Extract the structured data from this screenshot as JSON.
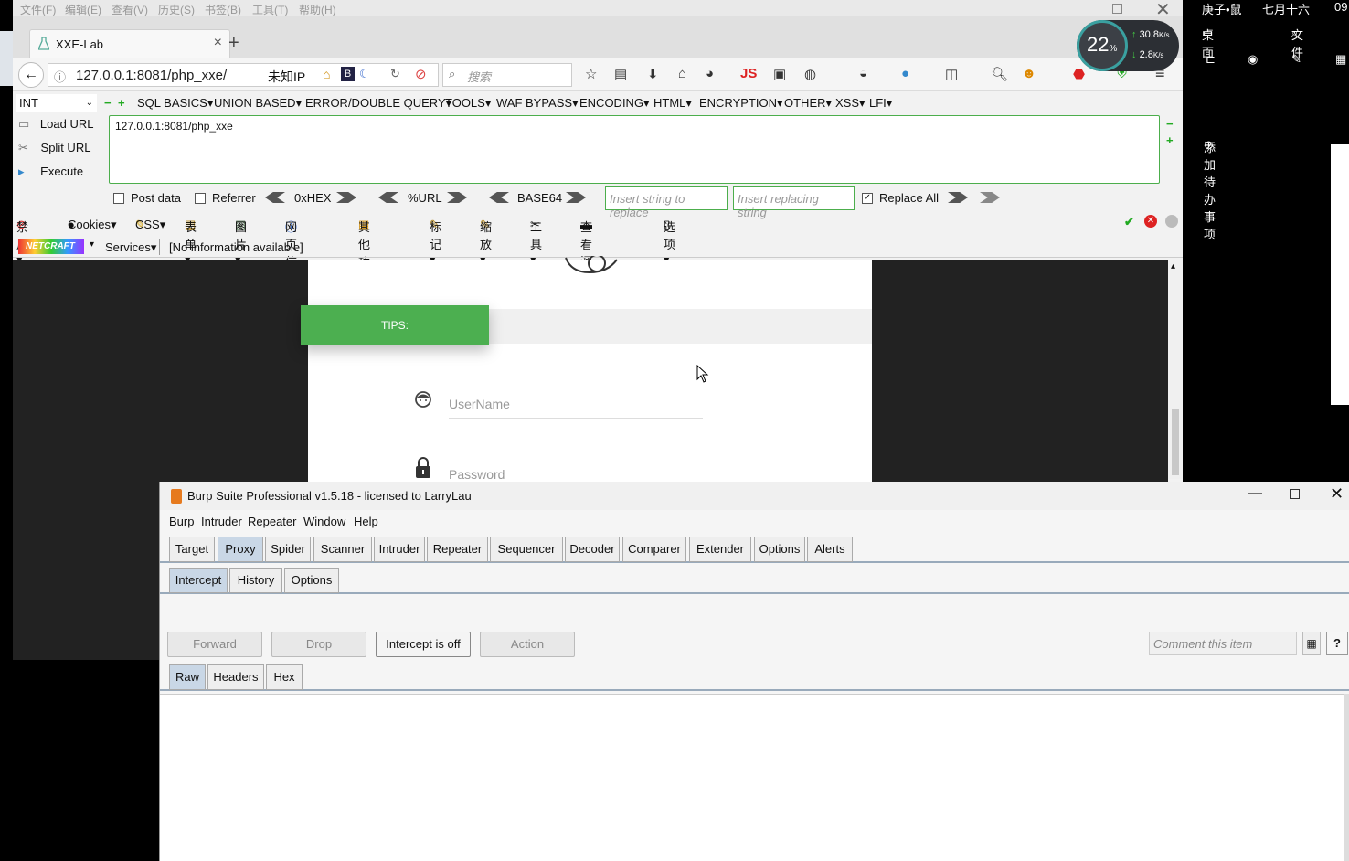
{
  "firefox": {
    "menubar": [
      "文件(F)",
      "编辑(E)",
      "查看(V)",
      "历史(S)",
      "书签(B)",
      "工具(T)",
      "帮助(H)"
    ],
    "tab_title": "XXE-Lab",
    "url": "127.0.0.1:8081/php_xxe/",
    "ip_label": "未知IP",
    "search_placeholder": "搜索"
  },
  "hackbar": {
    "select_value": "INT",
    "menu": [
      "SQL BASICS▾",
      "UNION BASED▾",
      "ERROR/DOUBLE QUERY▾",
      "TOOLS▾",
      "WAF BYPASS▾",
      "ENCODING▾",
      "HTML▾",
      "ENCRYPTION▾",
      "OTHER▾",
      "XSS▾",
      "LFI▾"
    ],
    "load_url": "Load URL",
    "split_url": "Split URL",
    "execute": "Execute",
    "url_value": "127.0.0.1:8081/php_xxe",
    "post_data": "Post data",
    "referrer": "Referrer",
    "hex": "0xHEX",
    "urlenc": "%URL",
    "base64": "BASE64",
    "replace_placeholder": "Insert string to replace",
    "replacing_placeholder": "Insert replacing string",
    "replace_all": "Replace All"
  },
  "webdev": [
    "禁用▾",
    "Cookies▾",
    "CSS▾",
    "表单▾",
    "图片▾",
    "网页信息▾",
    "其他功能▾",
    "标记▾",
    "缩放▾",
    "工具▾",
    "查看源代码▾",
    "选项▾"
  ],
  "netcraft": {
    "logo": "NETCRAFT",
    "services": "Services▾",
    "info": "[No information available]"
  },
  "page": {
    "tips": "TIPS:",
    "username_placeholder": "UserName",
    "password_placeholder": "Password"
  },
  "desktop": {
    "date1": "庚子•鼠",
    "date2": "七月十六",
    "time": "09",
    "desktop_label": "桌面",
    "file_label": "文件",
    "todo": "添加待办事项"
  },
  "speed": {
    "percent": "22",
    "up": "30.8",
    "down": "2.8",
    "unit": "K/s"
  },
  "burp": {
    "title": "Burp Suite Professional v1.5.18 - licensed to LarryLau",
    "menu": [
      "Burp",
      "Intruder",
      "Repeater",
      "Window",
      "Help"
    ],
    "tabs": [
      "Target",
      "Proxy",
      "Spider",
      "Scanner",
      "Intruder",
      "Repeater",
      "Sequencer",
      "Decoder",
      "Comparer",
      "Extender",
      "Options",
      "Alerts"
    ],
    "subtabs": [
      "Intercept",
      "History",
      "Options"
    ],
    "buttons": {
      "forward": "Forward",
      "drop": "Drop",
      "intercept": "Intercept is off",
      "action": "Action"
    },
    "comment_placeholder": "Comment this item",
    "viewtabs": [
      "Raw",
      "Headers",
      "Hex"
    ]
  }
}
